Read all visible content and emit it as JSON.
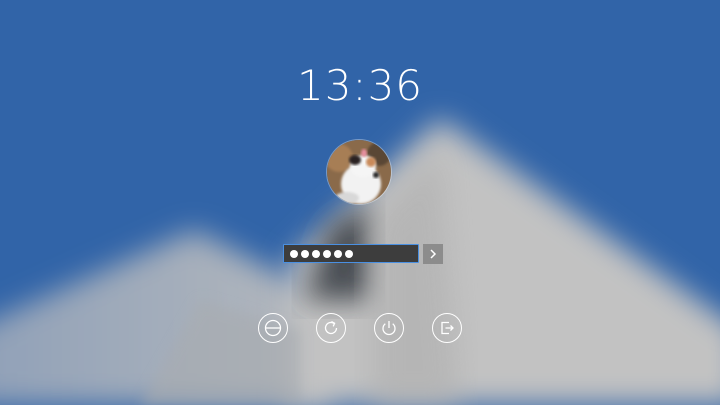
{
  "lock_screen": {
    "time": "13:36",
    "password": {
      "masked_length": 6,
      "border_color": "#4a90e2"
    },
    "login_button_icon": "chevron-right-icon",
    "avatar_subject": "cat"
  },
  "actions": [
    {
      "id": "suspend",
      "icon": "suspend-icon"
    },
    {
      "id": "restart",
      "icon": "restart-icon"
    },
    {
      "id": "shutdown",
      "icon": "power-icon"
    },
    {
      "id": "logout",
      "icon": "logout-icon"
    }
  ],
  "colors": {
    "sky": "#3164a8",
    "field_bg": "#3d3d3d",
    "accent": "#4a90e2",
    "button_grey": "#8c8c8c"
  }
}
